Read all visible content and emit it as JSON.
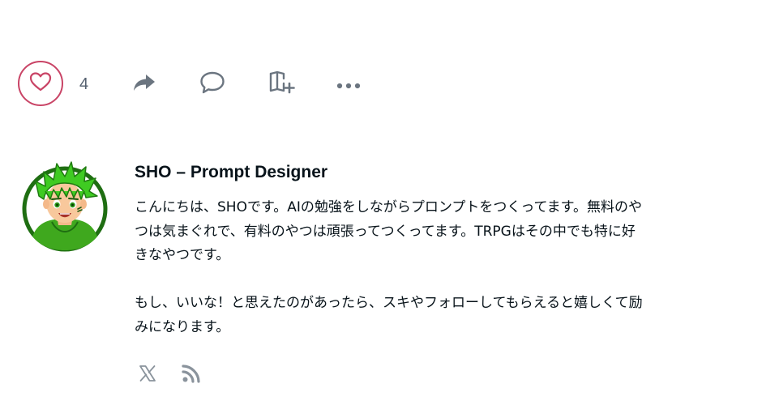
{
  "actions": {
    "like_count": "4"
  },
  "colors": {
    "like_accent": "#c94466",
    "icon_gray": "#6b7580",
    "text": "#08131a",
    "avatar_hair": "#3fcb22",
    "avatar_ring": "#1f6e12"
  },
  "author": {
    "name": "SHO – Prompt Designer",
    "bio_lines": [
      "こんにちは、SHOです。AIの勉強をしながらプロンプトをつくってます。無料のや",
      "つは気まぐれで、有料のやつは頑張ってつくってます。TRPGはその中でも特に好",
      "きなやつです。",
      "もし、いいな！と思えたのがあったら、スキやフォローしてもらえると嬉しくて励",
      "みになります。"
    ]
  },
  "icons": {
    "like": "heart-icon",
    "share": "share-arrow-icon",
    "comment": "comment-bubble-icon",
    "magazine": "magazine-add-icon",
    "more": "more-dots-icon",
    "x": "x-logo-icon",
    "rss": "rss-icon"
  }
}
